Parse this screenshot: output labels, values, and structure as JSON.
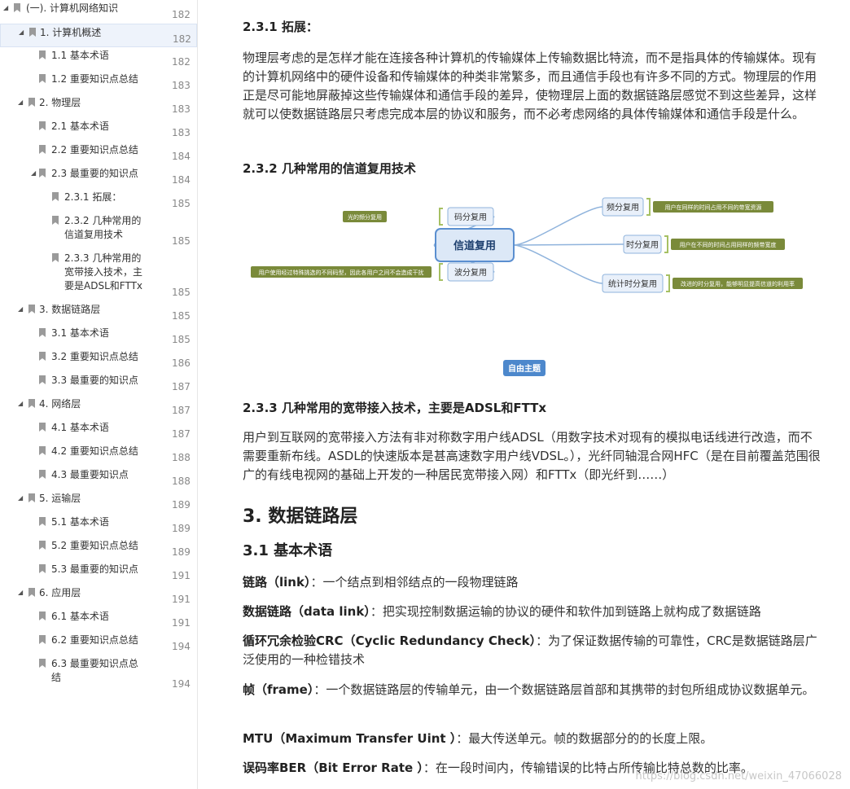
{
  "toc": [
    {
      "label": "(一). 计算机网络知识",
      "page": "182",
      "level": 0,
      "expanded": true,
      "selected": false
    },
    {
      "label": "1. 计算机概述",
      "page": "182",
      "level": 1,
      "expanded": true,
      "selected": true
    },
    {
      "label": "1.1 基本术语",
      "page": "182",
      "level": 2
    },
    {
      "label": "1.2 重要知识点总结",
      "page": "183",
      "level": 2
    },
    {
      "label": "2. 物理层",
      "page": "183",
      "level": 1,
      "expanded": true
    },
    {
      "label": "2.1 基本术语",
      "page": "183",
      "level": 2
    },
    {
      "label": "2.2 重要知识点总结",
      "page": "184",
      "level": 2
    },
    {
      "label": "2.3 最重要的知识点",
      "page": "184",
      "level": 2,
      "expanded": true
    },
    {
      "label": "2.3.1 拓展：",
      "page": "185",
      "level": 3
    },
    {
      "label": "2.3.2 几种常用的\n信道复用技术",
      "page": "185",
      "level": 3
    },
    {
      "label": "2.3.3 几种常用的\n宽带接入技术，主\n要是ADSL和FTTx",
      "page": "185",
      "level": 3
    },
    {
      "label": "3. 数据链路层",
      "page": "185",
      "level": 1,
      "expanded": true
    },
    {
      "label": "3.1 基本术语",
      "page": "185",
      "level": 2
    },
    {
      "label": "3.2 重要知识点总结",
      "page": "186",
      "level": 2
    },
    {
      "label": "3.3 最重要的知识点",
      "page": "187",
      "level": 2
    },
    {
      "label": "4. 网络层",
      "page": "187",
      "level": 1,
      "expanded": true
    },
    {
      "label": "4.1 基本术语",
      "page": "187",
      "level": 2
    },
    {
      "label": "4.2 重要知识点总结",
      "page": "188",
      "level": 2
    },
    {
      "label": "4.3 最重要知识点",
      "page": "188",
      "level": 2
    },
    {
      "label": "5. 运输层",
      "page": "189",
      "level": 1,
      "expanded": true
    },
    {
      "label": "5.1 基本术语",
      "page": "189",
      "level": 2
    },
    {
      "label": "5.2 重要知识点总结",
      "page": "189",
      "level": 2
    },
    {
      "label": "5.3 最重要的知识点",
      "page": "191",
      "level": 2
    },
    {
      "label": "6. 应用层",
      "page": "191",
      "level": 1,
      "expanded": true
    },
    {
      "label": "6.1 基本术语",
      "page": "191",
      "level": 2
    },
    {
      "label": "6.2 重要知识点总结",
      "page": "194",
      "level": 2
    },
    {
      "label": "6.3 最重要知识点总\n结",
      "page": "194",
      "level": 2
    }
  ],
  "content": {
    "s231_title": "2.3.1 拓展：",
    "s231_text": "物理层考虑的是怎样才能在连接各种计算机的传输媒体上传输数据比特流，而不是指具体的传输媒体。现有的计算机网络中的硬件设备和传输媒体的种类非常繁多，而且通信手段也有许多不同的方式。物理层的作用正是尽可能地屏蔽掉这些传输媒体和通信手段的差异，使物理层上面的数据链路层感觉不到这些差异，这样就可以使数据链路层只考虑完成本层的协议和服务，而不必考虑网络的具体传输媒体和通信手段是什么。",
    "s232_title": "2.3.2 几种常用的信道复用技术",
    "diagram": {
      "center": "信道复用",
      "left": [
        {
          "label": "码分复用",
          "note": "光的频分复用"
        },
        {
          "label": "波分复用",
          "note": "用户使用经过特殊挑选的不同码型，因此各用户之间不会造成干扰"
        }
      ],
      "right": [
        {
          "label": "频分复用",
          "note": "用户在同样的时间占用不同的带宽资源"
        },
        {
          "label": "时分复用",
          "note": "用户在不同的时间占用同样的频带宽度"
        },
        {
          "label": "统计时分复用",
          "note": "改进的时分复用，能够明显提高信道的利用率"
        }
      ],
      "free_topic": "自由主题",
      "colors": {
        "node_border": "#8fb3dc",
        "node_fill": "#e9f0fa",
        "center_fill": "#dce8f7",
        "center_border": "#5b8fd0",
        "note_fill": "#7a8a3a",
        "line": "#8fb3dc",
        "bracket": "#a6c063",
        "free_topic": "#4d88cc"
      }
    },
    "s233_title": "2.3.3 几种常用的宽带接入技术，主要是ADSL和FTTx",
    "s233_text": "用户到互联网的宽带接入方法有非对称数字用户线ADSL（用数字技术对现有的模拟电话线进行改造，而不需要重新布线。ASDL的快速版本是甚高速数字用户线VDSL。），光纤同轴混合网HFC（是在目前覆盖范围很广的有线电视网的基础上开发的一种居民宽带接入网）和FTTx（即光纤到……）",
    "s3_title": "3. 数据链路层",
    "s31_title": "3.1 基本术语",
    "terms": [
      {
        "term": "链路（link）",
        "def": "：一个结点到相邻结点的一段物理链路"
      },
      {
        "term": "数据链路（data link）",
        "def": "：把实现控制数据运输的协议的硬件和软件加到链路上就构成了数据链路"
      },
      {
        "term": "循环冗余检验CRC（Cyclic Redundancy Check）",
        "def": "：为了保证数据传输的可靠性，CRC是数据链路层广泛使用的一种检错技术"
      },
      {
        "term": "帧（frame）",
        "def": "：一个数据链路层的传输单元，由一个数据链路层首部和其携带的封包所组成协议数据单元。"
      },
      {
        "term": "MTU（Maximum Transfer Uint ）",
        "def": "：最大传送单元。帧的数据部分的的长度上限。"
      },
      {
        "term": "误码率BER（Bit Error Rate ）",
        "def": "：在一段时间内，传输错误的比特占所传输比特总数的比率。"
      }
    ],
    "watermark": "https://blog.csdn.net/weixin_47066028"
  }
}
